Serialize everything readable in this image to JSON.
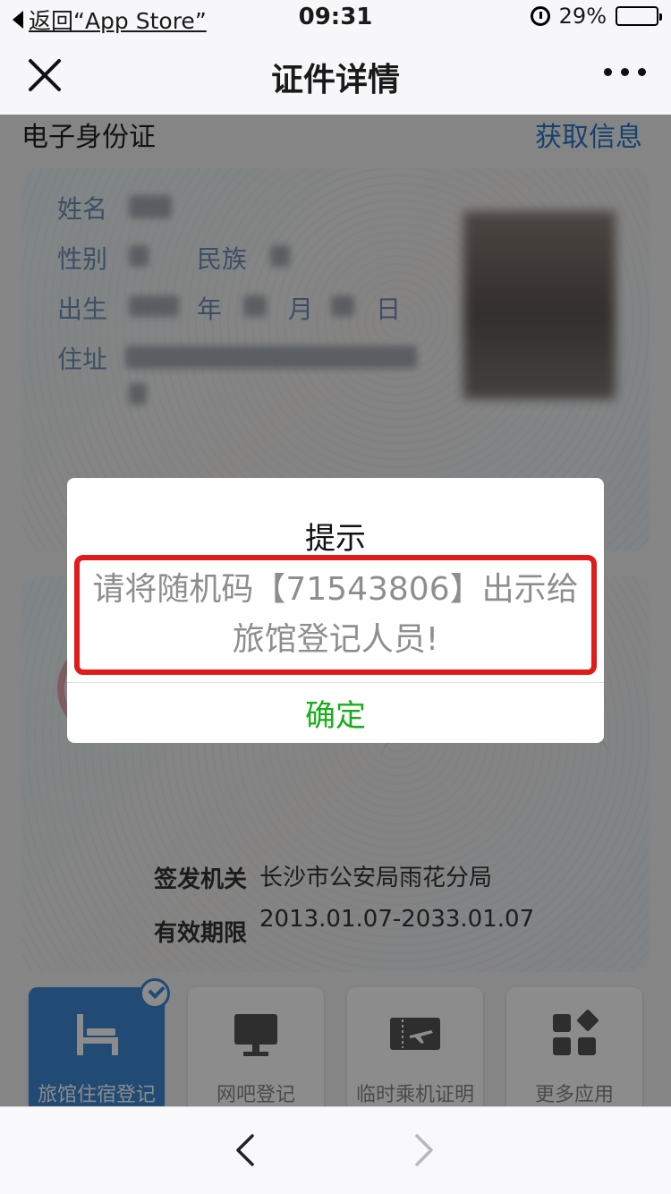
{
  "status_bar": {
    "back_label": "返回“App Store”",
    "time": "09:31",
    "battery": "29%",
    "battery_level": 0.29
  },
  "nav": {
    "title": "证件详情"
  },
  "section": {
    "title": "电子身份证",
    "action": "获取信息"
  },
  "id_card": {
    "name_label": "姓名",
    "gender_label": "性别",
    "ethnicity_label": "民族",
    "birth_label": "出生",
    "year_label": "年",
    "month_label": "月",
    "day_label": "日",
    "address_label": "住址",
    "authority_label": "签发机关",
    "authority_value": "长沙市公安局雨花分局",
    "validity_label": "有效期限",
    "validity_value": "2013.01.07-2033.01.07"
  },
  "tiles": [
    {
      "label": "旅馆住宿登记",
      "icon": "bed-icon",
      "active": true
    },
    {
      "label": "网吧登记",
      "icon": "monitor-icon",
      "active": false
    },
    {
      "label": "临时乘机证明",
      "icon": "boarding-pass-icon",
      "active": false
    },
    {
      "label": "更多应用",
      "icon": "apps-grid-icon",
      "active": false
    }
  ],
  "dialog": {
    "title": "提示",
    "message": "请将随机码【71543806】出示给旅馆登记人员!",
    "confirm": "确定"
  },
  "colors": {
    "accent_blue": "#3d88d4",
    "link_blue": "#2a78c8",
    "confirm_green": "#1aad19",
    "highlight_red": "#e11a1a"
  }
}
